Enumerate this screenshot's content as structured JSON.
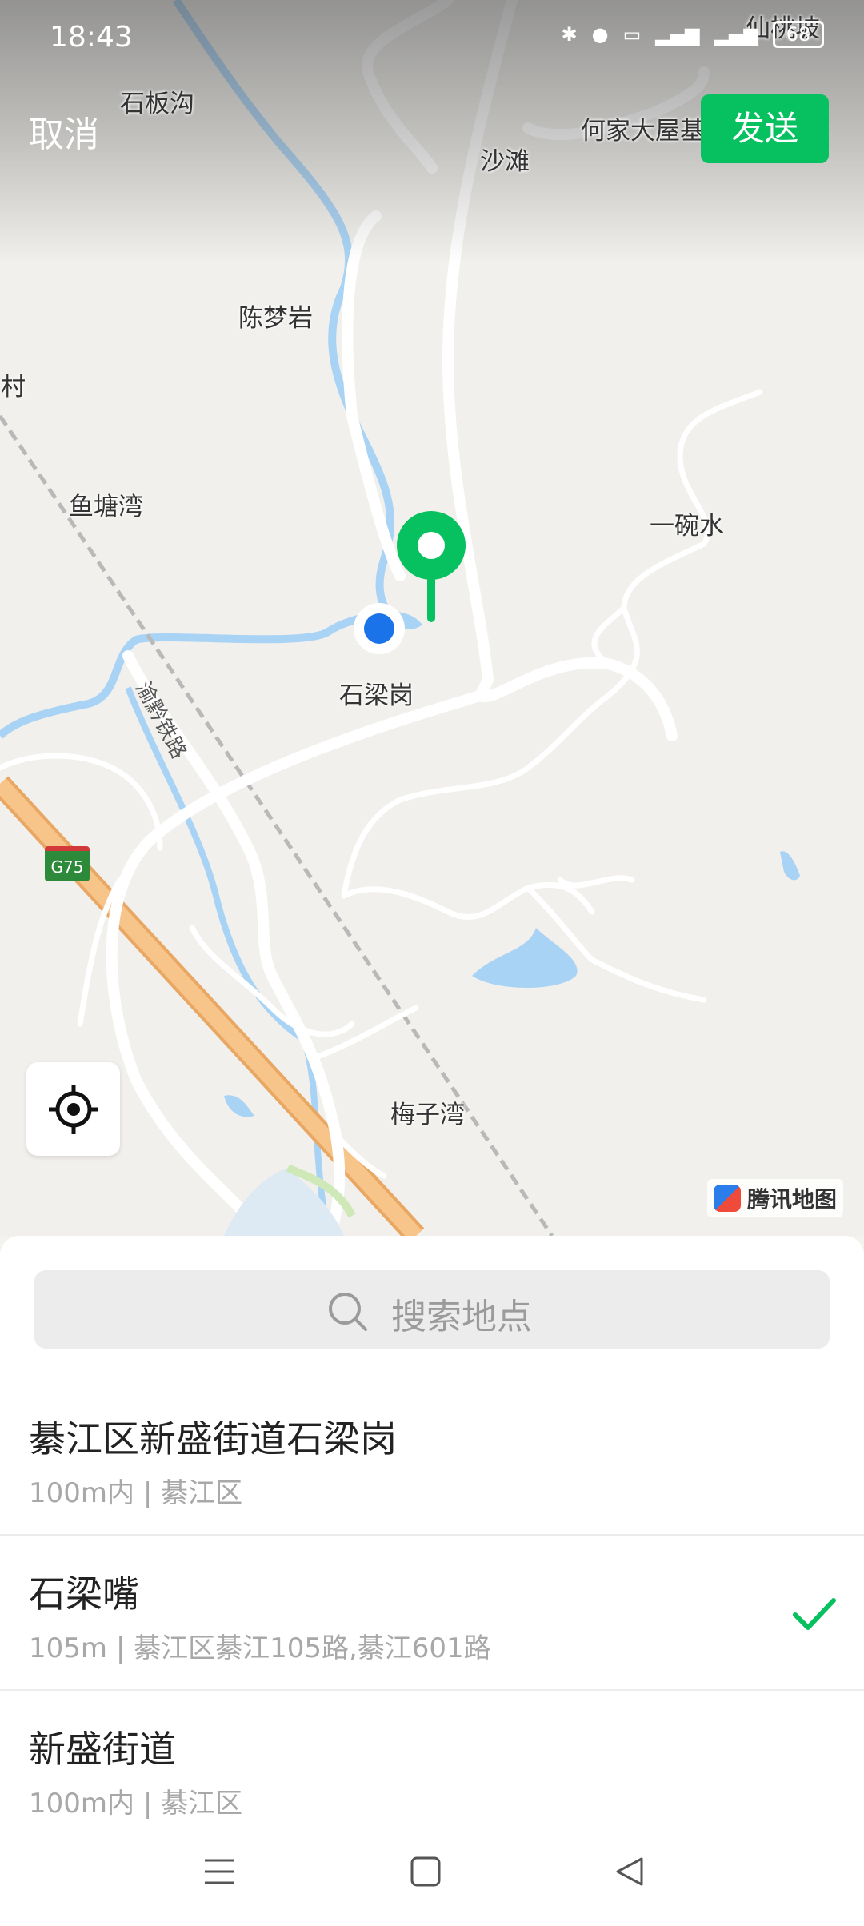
{
  "status_bar": {
    "time": "18:43",
    "battery": "68",
    "icons": [
      "bluetooth-icon",
      "location-icon",
      "hd-icon",
      "signal-4g-icon",
      "signal-4g-icon",
      "battery-icon"
    ]
  },
  "header": {
    "cancel_label": "取消",
    "send_label": "发送"
  },
  "map": {
    "place_labels": [
      "石板沟",
      "沙滩",
      "何家大屋基",
      "仙桃坡",
      "陈梦岩",
      "星村",
      "鱼塘湾",
      "一碗水",
      "石梁岗",
      "梅子湾"
    ],
    "railway_label": "渝黔铁路",
    "highway_badge": "G75",
    "provider_label": "腾讯地图",
    "colors": {
      "pin": "#07c160",
      "current_location": "#1a73e8",
      "highway": "#f5b26b",
      "water": "#a9d3f5"
    }
  },
  "search": {
    "placeholder": "搜索地点"
  },
  "results": [
    {
      "title": "綦江区新盛街道石梁岗",
      "subtitle": "100m内 | 綦江区",
      "selected": false
    },
    {
      "title": "石梁嘴",
      "subtitle": "105m | 綦江区綦江105路,綦江601路",
      "selected": true
    },
    {
      "title": "新盛街道",
      "subtitle": "100m内 | 綦江区",
      "selected": false
    }
  ],
  "nav": {
    "icons": [
      "menu-icon",
      "home-icon",
      "back-icon"
    ]
  },
  "accent_color": "#07c160"
}
